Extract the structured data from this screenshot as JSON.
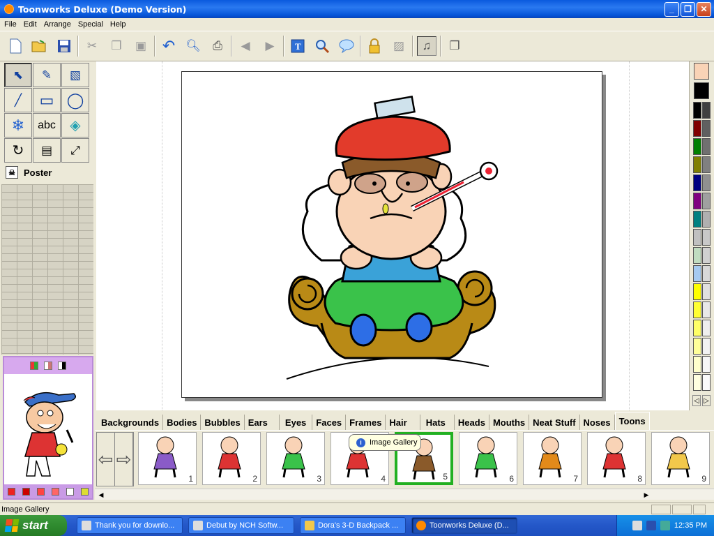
{
  "window": {
    "title": "Toonworks Deluxe (Demo Version)",
    "controls": [
      "_",
      "❐",
      "✕"
    ]
  },
  "menu": [
    "File",
    "Edit",
    "Arrange",
    "Special",
    "Help"
  ],
  "toolbar": {
    "icons": [
      "new-icon",
      "open-icon",
      "save-icon",
      "cut-icon",
      "copy-icon",
      "paste-icon",
      "undo-icon",
      "preview-icon",
      "print-icon",
      "back-icon",
      "forward-icon",
      "text-icon",
      "zoom-icon",
      "speech-bubble-icon",
      "lock-icon",
      "unlock-icon",
      "sound-icon",
      "window-icon"
    ]
  },
  "tools": {
    "items": [
      {
        "name": "select",
        "glyph": "⬉"
      },
      {
        "name": "pen",
        "glyph": "✎"
      },
      {
        "name": "draw-wizard",
        "glyph": "▧"
      },
      {
        "name": "line",
        "glyph": "╱"
      },
      {
        "name": "rectangle",
        "glyph": "▭"
      },
      {
        "name": "ellipse",
        "glyph": "◯"
      },
      {
        "name": "snowflake",
        "glyph": "❄"
      },
      {
        "name": "text",
        "glyph": "abc"
      },
      {
        "name": "fill-bucket",
        "glyph": "◈"
      },
      {
        "name": "rotate",
        "glyph": "↻"
      },
      {
        "name": "stamp",
        "glyph": "▤"
      },
      {
        "name": "transform",
        "glyph": "⤢"
      }
    ],
    "poster_label": "Poster"
  },
  "palette": {
    "fill_color": "#f9d3b6",
    "line_color": "#000000",
    "swatches": [
      [
        "#000000",
        "#404040"
      ],
      [
        "#800000",
        "#606060"
      ],
      [
        "#008000",
        "#707070"
      ],
      [
        "#808000",
        "#808080"
      ],
      [
        "#000080",
        "#909090"
      ],
      [
        "#800080",
        "#a0a0a0"
      ],
      [
        "#008080",
        "#b0b0b0"
      ],
      [
        "#c0c0c0",
        "#c8c8c8"
      ],
      [
        "#c0dcc0",
        "#d0d0d0"
      ],
      [
        "#a6caf0",
        "#d8d8d8"
      ],
      [
        "#ffff00",
        "#e0e0e0"
      ],
      [
        "#ffff33",
        "#e8e8e8"
      ],
      [
        "#ffff66",
        "#eeeeee"
      ],
      [
        "#ffff99",
        "#f2f2f2"
      ],
      [
        "#ffffcc",
        "#f6f6f6"
      ],
      [
        "#ffffe0",
        "#fafafa"
      ]
    ]
  },
  "categories": [
    "Backgrounds",
    "Bodies",
    "Bubbles",
    "Ears",
    "Eyes",
    "Faces",
    "Frames",
    "Hair",
    "Hats",
    "Heads",
    "Mouths",
    "Neat Stuff",
    "Noses",
    "Toons"
  ],
  "active_category": "Toons",
  "gallery": {
    "items": [
      "1",
      "2",
      "3",
      "4",
      "5",
      "6",
      "7",
      "8",
      "9"
    ],
    "selected": "5",
    "tooltip": "Image Gallery"
  },
  "status": "Image Gallery",
  "taskbar": {
    "start": "start",
    "tasks": [
      {
        "label": "Thank you for downlo...",
        "active": false
      },
      {
        "label": "Debut by NCH Softw...",
        "active": false
      },
      {
        "label": "Dora's 3-D Backpack ...",
        "active": false
      },
      {
        "label": "Toonworks Deluxe (D...",
        "active": true
      }
    ],
    "clock": "12:35 PM"
  }
}
